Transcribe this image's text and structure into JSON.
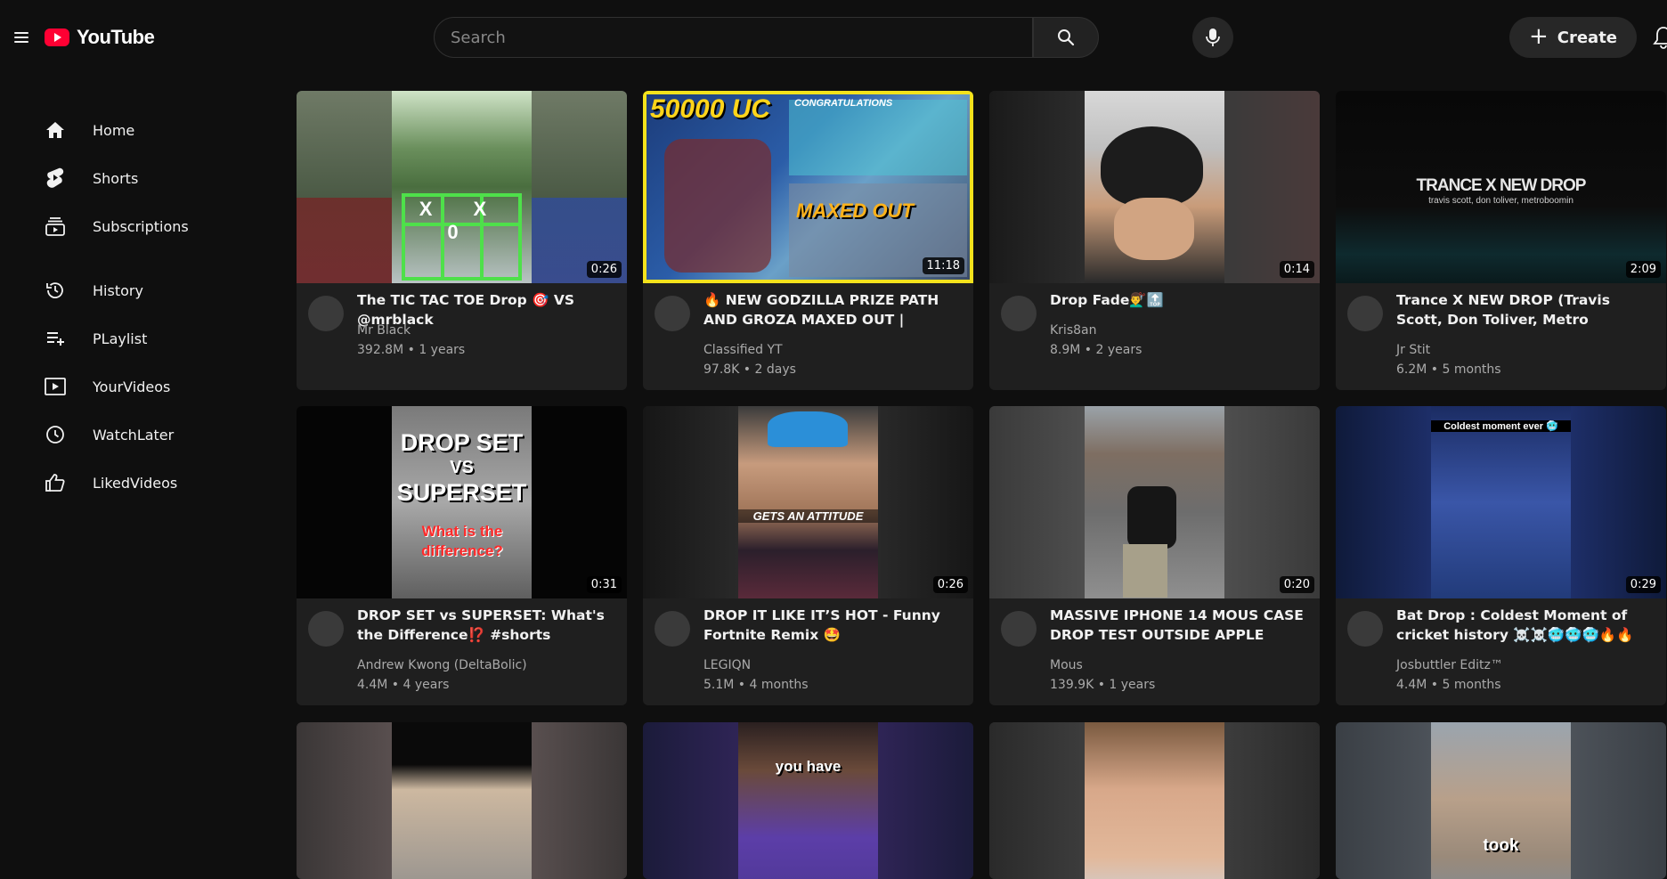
{
  "header": {
    "logo_text": "YouTube",
    "search_placeholder": "Search",
    "create_label": "Create"
  },
  "sidebar": {
    "items": [
      {
        "label": "Home",
        "icon": "home-icon"
      },
      {
        "label": "Shorts",
        "icon": "shorts-icon"
      },
      {
        "label": "Subscriptions",
        "icon": "subscriptions-icon"
      },
      {
        "label": "History",
        "icon": "history-icon"
      },
      {
        "label": "PLaylist",
        "icon": "playlist-icon"
      },
      {
        "label": "YourVideos",
        "icon": "your-videos-icon"
      },
      {
        "label": "WatchLater",
        "icon": "watch-later-icon"
      },
      {
        "label": "LikedVideos",
        "icon": "liked-videos-icon"
      }
    ]
  },
  "videos": [
    {
      "title": "The TIC TAC TOE Drop 🎯 VS @mrblack",
      "channel": "Mr Black",
      "stats": "392.8M • 1 years",
      "duration": "0:26",
      "thumb_text": "X X 0"
    },
    {
      "title": "🔥 NEW GODZILLA PRIZE PATH AND GROZA MAXED OUT | GODZILLA LUCK...",
      "channel": "Classified YT",
      "stats": "97.8K • 2 days",
      "duration": "11:18",
      "thumb_text": "50000 UC",
      "thumb_text2": "CONGRATULATIONS",
      "thumb_text3": "MAXED OUT"
    },
    {
      "title": "Drop Fade💇‍♂️🔝",
      "channel": "Kris8an",
      "stats": "8.9M • 2 years",
      "duration": "0:14"
    },
    {
      "title": "Trance X NEW DROP (Travis Scott, Don Toliver, Metro Boomin) [Jr Stit Mashup]",
      "channel": "Jr Stit",
      "stats": "6.2M • 5 months",
      "duration": "2:09",
      "thumb_text": "TRANCE X NEW DROP",
      "thumb_text2": "travis scott, don toliver, metroboomin"
    },
    {
      "title": "DROP SET vs SUPERSET: What's the Difference⁉️ #shorts",
      "channel": "Andrew Kwong (DeltaBolic)",
      "stats": "4.4M • 4 years",
      "duration": "0:31",
      "thumb_text": "DROP SET",
      "thumb_text2": "VS",
      "thumb_text3": "SUPERSET",
      "thumb_text4": "What is the difference?"
    },
    {
      "title": "DROP IT LIKE IT’S HOT - Funny Fortnite Remix 🤩",
      "channel": "LEGIQN",
      "stats": "5.1M • 4 months",
      "duration": "0:26",
      "thumb_text": "GETS AN ATTITUDE"
    },
    {
      "title": "MASSIVE IPHONE 14 MOUS CASE DROP TEST OUTSIDE APPLE STORE",
      "channel": "Mous",
      "stats": "139.9K • 1 years",
      "duration": "0:20"
    },
    {
      "title": "Bat Drop : Coldest Moment of cricket history ☠️☠️🥶🥶🥶🔥🔥 #joeroot...",
      "channel": "Josbuttler Editz™",
      "stats": "4.4M • 5 months",
      "duration": "0:29",
      "thumb_text": "Coldest moment ever 🥶"
    },
    {
      "title": "",
      "channel": "",
      "stats": "",
      "duration": ""
    },
    {
      "title": "",
      "channel": "",
      "stats": "",
      "duration": "",
      "thumb_text": "you have"
    },
    {
      "title": "",
      "channel": "",
      "stats": "",
      "duration": ""
    },
    {
      "title": "",
      "channel": "",
      "stats": "",
      "duration": "",
      "thumb_text": "took"
    }
  ]
}
